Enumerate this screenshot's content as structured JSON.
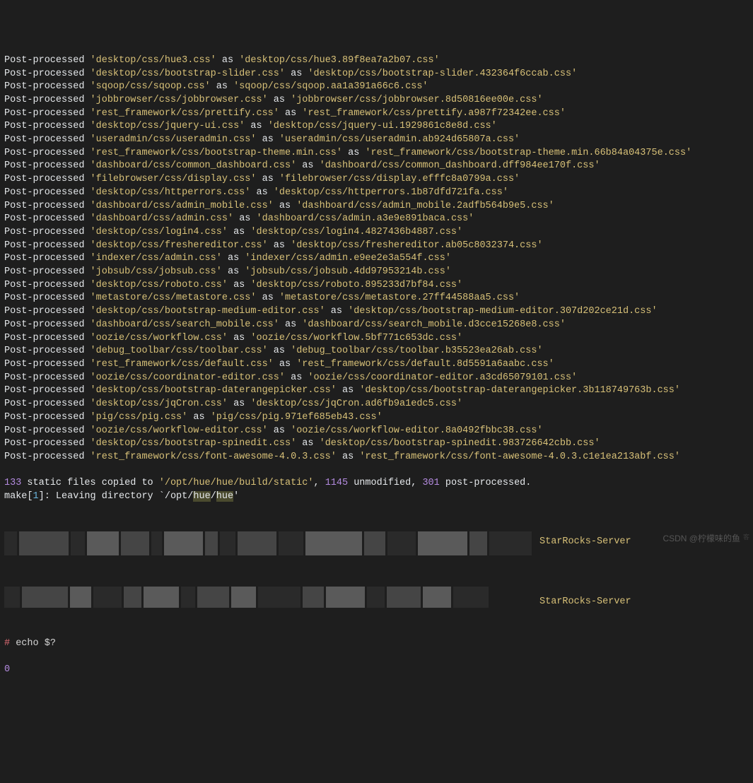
{
  "log_prefix": "Post-processed",
  "as_word": "as",
  "entries": [
    {
      "src": "'desktop/css/hue3.css'",
      "dst": "'desktop/css/hue3.89f8ea7a2b07.css'"
    },
    {
      "src": "'desktop/css/bootstrap-slider.css'",
      "dst": "'desktop/css/bootstrap-slider.432364f6ccab.css'"
    },
    {
      "src": "'sqoop/css/sqoop.css'",
      "dst": "'sqoop/css/sqoop.aa1a391a66c6.css'"
    },
    {
      "src": "'jobbrowser/css/jobbrowser.css'",
      "dst": "'jobbrowser/css/jobbrowser.8d50816ee00e.css'"
    },
    {
      "src": "'rest_framework/css/prettify.css'",
      "dst": "'rest_framework/css/prettify.a987f72342ee.css'"
    },
    {
      "src": "'desktop/css/jquery-ui.css'",
      "dst": "'desktop/css/jquery-ui.1929861c8e8d.css'"
    },
    {
      "src": "'useradmin/css/useradmin.css'",
      "dst": "'useradmin/css/useradmin.ab924d65807a.css'"
    },
    {
      "src": "'rest_framework/css/bootstrap-theme.min.css'",
      "dst": "'rest_framework/css/bootstrap-theme.min.66b84a04375e.css'"
    },
    {
      "src": "'dashboard/css/common_dashboard.css'",
      "dst": "'dashboard/css/common_dashboard.dff984ee170f.css'"
    },
    {
      "src": "'filebrowser/css/display.css'",
      "dst": "'filebrowser/css/display.efffc8a0799a.css'"
    },
    {
      "src": "'desktop/css/httperrors.css'",
      "dst": "'desktop/css/httperrors.1b87dfd721fa.css'"
    },
    {
      "src": "'dashboard/css/admin_mobile.css'",
      "dst": "'dashboard/css/admin_mobile.2adfb564b9e5.css'"
    },
    {
      "src": "'dashboard/css/admin.css'",
      "dst": "'dashboard/css/admin.a3e9e891baca.css'"
    },
    {
      "src": "'desktop/css/login4.css'",
      "dst": "'desktop/css/login4.4827436b4887.css'"
    },
    {
      "src": "'desktop/css/freshereditor.css'",
      "dst": "'desktop/css/freshereditor.ab05c8032374.css'"
    },
    {
      "src": "'indexer/css/admin.css'",
      "dst": "'indexer/css/admin.e9ee2e3a554f.css'"
    },
    {
      "src": "'jobsub/css/jobsub.css'",
      "dst": "'jobsub/css/jobsub.4dd97953214b.css'"
    },
    {
      "src": "'desktop/css/roboto.css'",
      "dst": "'desktop/css/roboto.895233d7bf84.css'"
    },
    {
      "src": "'metastore/css/metastore.css'",
      "dst": "'metastore/css/metastore.27ff44588aa5.css'"
    },
    {
      "src": "'desktop/css/bootstrap-medium-editor.css'",
      "dst": "'desktop/css/bootstrap-medium-editor.307d202ce21d.css'"
    },
    {
      "src": "'dashboard/css/search_mobile.css'",
      "dst": "'dashboard/css/search_mobile.d3cce15268e8.css'"
    },
    {
      "src": "'oozie/css/workflow.css'",
      "dst": "'oozie/css/workflow.5bf771c653dc.css'"
    },
    {
      "src": "'debug_toolbar/css/toolbar.css'",
      "dst": "'debug_toolbar/css/toolbar.b35523ea26ab.css'"
    },
    {
      "src": "'rest_framework/css/default.css'",
      "dst": "'rest_framework/css/default.8d5591a6aabc.css'"
    },
    {
      "src": "'oozie/css/coordinator-editor.css'",
      "dst": "'oozie/css/coordinator-editor.a3cd65079101.css'"
    },
    {
      "src": "'desktop/css/bootstrap-daterangepicker.css'",
      "dst": "'desktop/css/bootstrap-daterangepicker.3b118749763b.css'"
    },
    {
      "src": "'desktop/css/jqCron.css'",
      "dst": "'desktop/css/jqCron.ad6fb9a1edc5.css'"
    },
    {
      "src": "'pig/css/pig.css'",
      "dst": "'pig/css/pig.971ef685eb43.css'"
    },
    {
      "src": "'oozie/css/workflow-editor.css'",
      "dst": "'oozie/css/workflow-editor.8a0492fbbc38.css'"
    },
    {
      "src": "'desktop/css/bootstrap-spinedit.css'",
      "dst": "'desktop/css/bootstrap-spinedit.983726642cbb.css'"
    },
    {
      "src": "'rest_framework/css/font-awesome-4.0.3.css'",
      "dst": "'rest_framework/css/font-awesome-4.0.3.c1e1ea213abf.css'"
    }
  ],
  "summary": {
    "copied_count": "133",
    "copied_text_1": " static files copied to ",
    "copied_path": "'/opt/hue/hue/build/static'",
    "comma1": ", ",
    "unmodified_count": "1145",
    "unmodified_text": " unmodified, ",
    "postprocessed_count": "301",
    "postprocessed_text": " post-processed."
  },
  "make_line": {
    "prefix": "make[",
    "num": "1",
    "mid": "]: Leaving directory `/opt/",
    "hue1": "hue",
    "slash": "/",
    "hue2": "hue",
    "end": "'"
  },
  "starrocks_label": "StarRocks-Server",
  "prompt": {
    "hash": "#",
    "cmd": " echo $?"
  },
  "result": "0",
  "watermark": "CSDN @柠檬味的鱼",
  "watermark_small": "客"
}
